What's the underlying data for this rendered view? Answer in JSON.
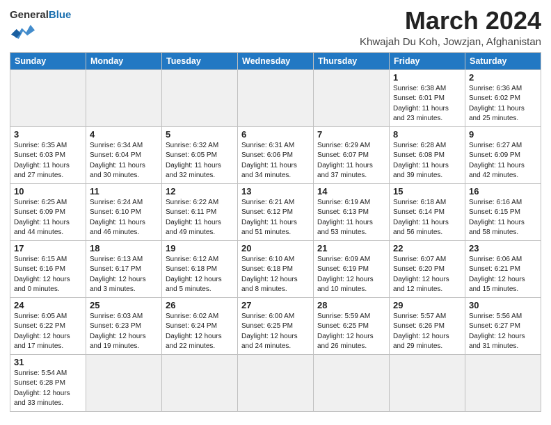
{
  "header": {
    "logo_general": "General",
    "logo_blue": "Blue",
    "title": "March 2024",
    "subtitle": "Khwajah Du Koh, Jowzjan, Afghanistan"
  },
  "days_of_week": [
    "Sunday",
    "Monday",
    "Tuesday",
    "Wednesday",
    "Thursday",
    "Friday",
    "Saturday"
  ],
  "weeks": [
    [
      {
        "day": "",
        "info": ""
      },
      {
        "day": "",
        "info": ""
      },
      {
        "day": "",
        "info": ""
      },
      {
        "day": "",
        "info": ""
      },
      {
        "day": "",
        "info": ""
      },
      {
        "day": "1",
        "info": "Sunrise: 6:38 AM\nSunset: 6:01 PM\nDaylight: 11 hours\nand 23 minutes."
      },
      {
        "day": "2",
        "info": "Sunrise: 6:36 AM\nSunset: 6:02 PM\nDaylight: 11 hours\nand 25 minutes."
      }
    ],
    [
      {
        "day": "3",
        "info": "Sunrise: 6:35 AM\nSunset: 6:03 PM\nDaylight: 11 hours\nand 27 minutes."
      },
      {
        "day": "4",
        "info": "Sunrise: 6:34 AM\nSunset: 6:04 PM\nDaylight: 11 hours\nand 30 minutes."
      },
      {
        "day": "5",
        "info": "Sunrise: 6:32 AM\nSunset: 6:05 PM\nDaylight: 11 hours\nand 32 minutes."
      },
      {
        "day": "6",
        "info": "Sunrise: 6:31 AM\nSunset: 6:06 PM\nDaylight: 11 hours\nand 34 minutes."
      },
      {
        "day": "7",
        "info": "Sunrise: 6:29 AM\nSunset: 6:07 PM\nDaylight: 11 hours\nand 37 minutes."
      },
      {
        "day": "8",
        "info": "Sunrise: 6:28 AM\nSunset: 6:08 PM\nDaylight: 11 hours\nand 39 minutes."
      },
      {
        "day": "9",
        "info": "Sunrise: 6:27 AM\nSunset: 6:09 PM\nDaylight: 11 hours\nand 42 minutes."
      }
    ],
    [
      {
        "day": "10",
        "info": "Sunrise: 6:25 AM\nSunset: 6:09 PM\nDaylight: 11 hours\nand 44 minutes."
      },
      {
        "day": "11",
        "info": "Sunrise: 6:24 AM\nSunset: 6:10 PM\nDaylight: 11 hours\nand 46 minutes."
      },
      {
        "day": "12",
        "info": "Sunrise: 6:22 AM\nSunset: 6:11 PM\nDaylight: 11 hours\nand 49 minutes."
      },
      {
        "day": "13",
        "info": "Sunrise: 6:21 AM\nSunset: 6:12 PM\nDaylight: 11 hours\nand 51 minutes."
      },
      {
        "day": "14",
        "info": "Sunrise: 6:19 AM\nSunset: 6:13 PM\nDaylight: 11 hours\nand 53 minutes."
      },
      {
        "day": "15",
        "info": "Sunrise: 6:18 AM\nSunset: 6:14 PM\nDaylight: 11 hours\nand 56 minutes."
      },
      {
        "day": "16",
        "info": "Sunrise: 6:16 AM\nSunset: 6:15 PM\nDaylight: 11 hours\nand 58 minutes."
      }
    ],
    [
      {
        "day": "17",
        "info": "Sunrise: 6:15 AM\nSunset: 6:16 PM\nDaylight: 12 hours\nand 0 minutes."
      },
      {
        "day": "18",
        "info": "Sunrise: 6:13 AM\nSunset: 6:17 PM\nDaylight: 12 hours\nand 3 minutes."
      },
      {
        "day": "19",
        "info": "Sunrise: 6:12 AM\nSunset: 6:18 PM\nDaylight: 12 hours\nand 5 minutes."
      },
      {
        "day": "20",
        "info": "Sunrise: 6:10 AM\nSunset: 6:18 PM\nDaylight: 12 hours\nand 8 minutes."
      },
      {
        "day": "21",
        "info": "Sunrise: 6:09 AM\nSunset: 6:19 PM\nDaylight: 12 hours\nand 10 minutes."
      },
      {
        "day": "22",
        "info": "Sunrise: 6:07 AM\nSunset: 6:20 PM\nDaylight: 12 hours\nand 12 minutes."
      },
      {
        "day": "23",
        "info": "Sunrise: 6:06 AM\nSunset: 6:21 PM\nDaylight: 12 hours\nand 15 minutes."
      }
    ],
    [
      {
        "day": "24",
        "info": "Sunrise: 6:05 AM\nSunset: 6:22 PM\nDaylight: 12 hours\nand 17 minutes."
      },
      {
        "day": "25",
        "info": "Sunrise: 6:03 AM\nSunset: 6:23 PM\nDaylight: 12 hours\nand 19 minutes."
      },
      {
        "day": "26",
        "info": "Sunrise: 6:02 AM\nSunset: 6:24 PM\nDaylight: 12 hours\nand 22 minutes."
      },
      {
        "day": "27",
        "info": "Sunrise: 6:00 AM\nSunset: 6:25 PM\nDaylight: 12 hours\nand 24 minutes."
      },
      {
        "day": "28",
        "info": "Sunrise: 5:59 AM\nSunset: 6:25 PM\nDaylight: 12 hours\nand 26 minutes."
      },
      {
        "day": "29",
        "info": "Sunrise: 5:57 AM\nSunset: 6:26 PM\nDaylight: 12 hours\nand 29 minutes."
      },
      {
        "day": "30",
        "info": "Sunrise: 5:56 AM\nSunset: 6:27 PM\nDaylight: 12 hours\nand 31 minutes."
      }
    ],
    [
      {
        "day": "31",
        "info": "Sunrise: 5:54 AM\nSunset: 6:28 PM\nDaylight: 12 hours\nand 33 minutes."
      },
      {
        "day": "",
        "info": ""
      },
      {
        "day": "",
        "info": ""
      },
      {
        "day": "",
        "info": ""
      },
      {
        "day": "",
        "info": ""
      },
      {
        "day": "",
        "info": ""
      },
      {
        "day": "",
        "info": ""
      }
    ]
  ]
}
